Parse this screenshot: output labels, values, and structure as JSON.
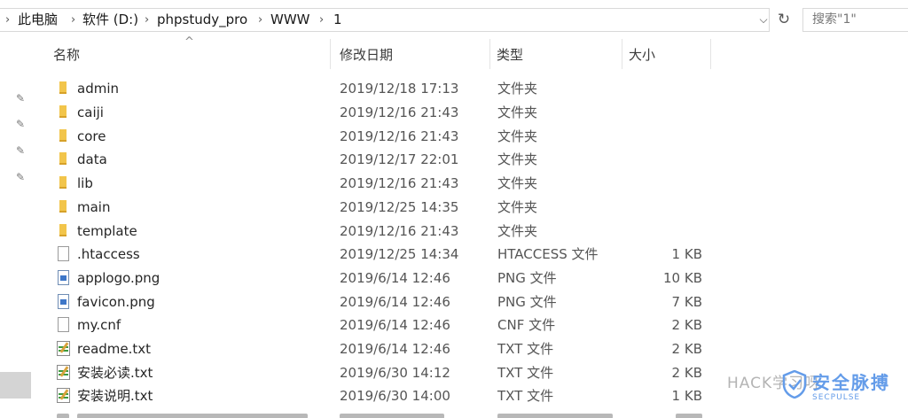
{
  "breadcrumb": [
    "此电脑",
    "软件 (D:)",
    "phpstudy_pro",
    "WWW",
    "1"
  ],
  "search": {
    "placeholder": "搜索\"1\""
  },
  "columns": {
    "name": "名称",
    "date": "修改日期",
    "type": "类型",
    "size": "大小"
  },
  "files": [
    {
      "name": "admin",
      "date": "2019/12/18 17:13",
      "type": "文件夹",
      "size": "",
      "icon": "folder-icon"
    },
    {
      "name": "caiji",
      "date": "2019/12/16 21:43",
      "type": "文件夹",
      "size": "",
      "icon": "folder-icon"
    },
    {
      "name": "core",
      "date": "2019/12/16 21:43",
      "type": "文件夹",
      "size": "",
      "icon": "folder-icon"
    },
    {
      "name": "data",
      "date": "2019/12/17 22:01",
      "type": "文件夹",
      "size": "",
      "icon": "folder-icon"
    },
    {
      "name": "lib",
      "date": "2019/12/16 21:43",
      "type": "文件夹",
      "size": "",
      "icon": "folder-icon"
    },
    {
      "name": "main",
      "date": "2019/12/25 14:35",
      "type": "文件夹",
      "size": "",
      "icon": "folder-icon"
    },
    {
      "name": "template",
      "date": "2019/12/16 21:43",
      "type": "文件夹",
      "size": "",
      "icon": "folder-icon"
    },
    {
      "name": ".htaccess",
      "date": "2019/12/25 14:34",
      "type": "HTACCESS 文件",
      "size": "1 KB",
      "icon": "file-icon"
    },
    {
      "name": "applogo.png",
      "date": "2019/6/14 12:46",
      "type": "PNG 文件",
      "size": "10 KB",
      "icon": "image-file-icon"
    },
    {
      "name": "favicon.png",
      "date": "2019/6/14 12:46",
      "type": "PNG 文件",
      "size": "7 KB",
      "icon": "image-file-icon"
    },
    {
      "name": "my.cnf",
      "date": "2019/6/14 12:46",
      "type": "CNF 文件",
      "size": "2 KB",
      "icon": "file-icon"
    },
    {
      "name": "readme.txt",
      "date": "2019/6/14 12:46",
      "type": "TXT 文件",
      "size": "2 KB",
      "icon": "text-file-icon"
    },
    {
      "name": "安装必读.txt",
      "date": "2019/6/30 14:12",
      "type": "TXT 文件",
      "size": "2 KB",
      "icon": "text-file-icon"
    },
    {
      "name": "安装说明.txt",
      "date": "2019/6/30 14:00",
      "type": "TXT 文件",
      "size": "1 KB",
      "icon": "text-file-icon"
    }
  ],
  "watermark": {
    "wechat": "HACK学习呀",
    "brand": "安全脉搏",
    "brand_en": "SECPULSE"
  }
}
